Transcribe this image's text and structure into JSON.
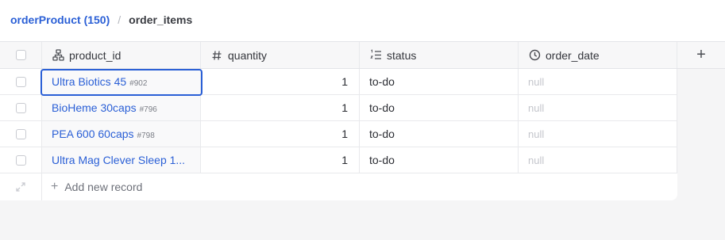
{
  "breadcrumb": {
    "parent": "orderProduct (150)",
    "separator": "/",
    "current": "order_items"
  },
  "columns": [
    {
      "label": "product_id",
      "icon": "relation-icon"
    },
    {
      "label": "quantity",
      "icon": "hash-icon"
    },
    {
      "label": "status",
      "icon": "list-numbered-icon"
    },
    {
      "label": "order_date",
      "icon": "clock-icon"
    }
  ],
  "add_column_label": "+",
  "rows": [
    {
      "product": "Ultra Biotics 45",
      "product_ref": "#902",
      "quantity": "1",
      "status": "to-do",
      "order_date": "null"
    },
    {
      "product": "BioHeme 30caps",
      "product_ref": "#796",
      "quantity": "1",
      "status": "to-do",
      "order_date": "null"
    },
    {
      "product": "PEA 600 60caps",
      "product_ref": "#798",
      "quantity": "1",
      "status": "to-do",
      "order_date": "null"
    },
    {
      "product": "Ultra Mag Clever Sleep 1...",
      "product_ref": "",
      "quantity": "1",
      "status": "to-do",
      "order_date": "null"
    }
  ],
  "add_record_label": "Add new record",
  "colors": {
    "accent": "#2a5fd6",
    "null_text": "#c4c6cc"
  }
}
